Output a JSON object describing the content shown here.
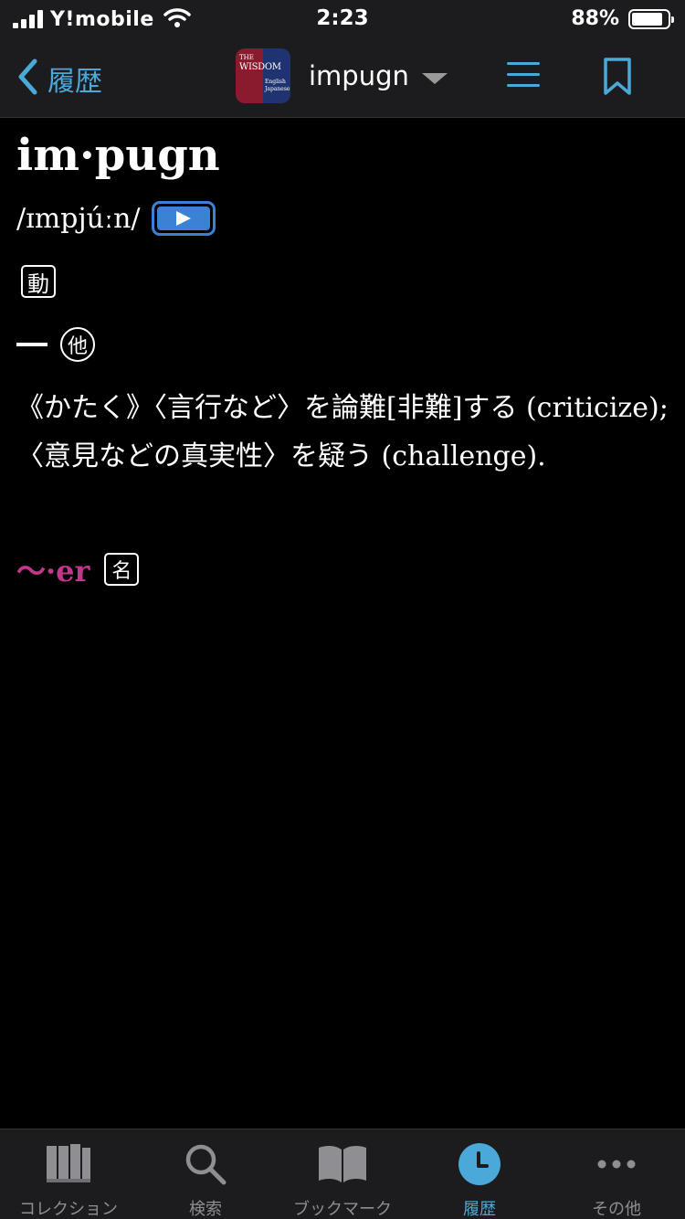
{
  "status_bar": {
    "carrier": "Y!mobile",
    "time": "2:23",
    "battery_pct": "88%",
    "battery_level": 0.88
  },
  "nav": {
    "back_label": "履歴",
    "dict_logo": {
      "line1": "THE",
      "line2": "WISDOM",
      "line3": "English",
      "line4": "Japanese"
    },
    "word": "impugn",
    "accent_color": "#4aa9d8"
  },
  "entry": {
    "headword": "im·pugn",
    "pronunciation": "/ɪmpjúːn/",
    "pos_label": "動",
    "sense_dash": "—",
    "transitive_mark": "他",
    "definition": "《かたく》〈言行など〉を論難[非難]する (criticize);〈意見などの真実性〉を疑う (challenge).",
    "derived": "〜·er",
    "derived_pos": "名",
    "derived_color": "#c2368c"
  },
  "tabs": [
    {
      "label": "コレクション",
      "icon": "books-icon",
      "active": false
    },
    {
      "label": "検索",
      "icon": "search-icon",
      "active": false
    },
    {
      "label": "ブックマーク",
      "icon": "open-book-icon",
      "active": false
    },
    {
      "label": "履歴",
      "icon": "clock-icon",
      "active": true
    },
    {
      "label": "その他",
      "icon": "more-icon",
      "active": false
    }
  ]
}
